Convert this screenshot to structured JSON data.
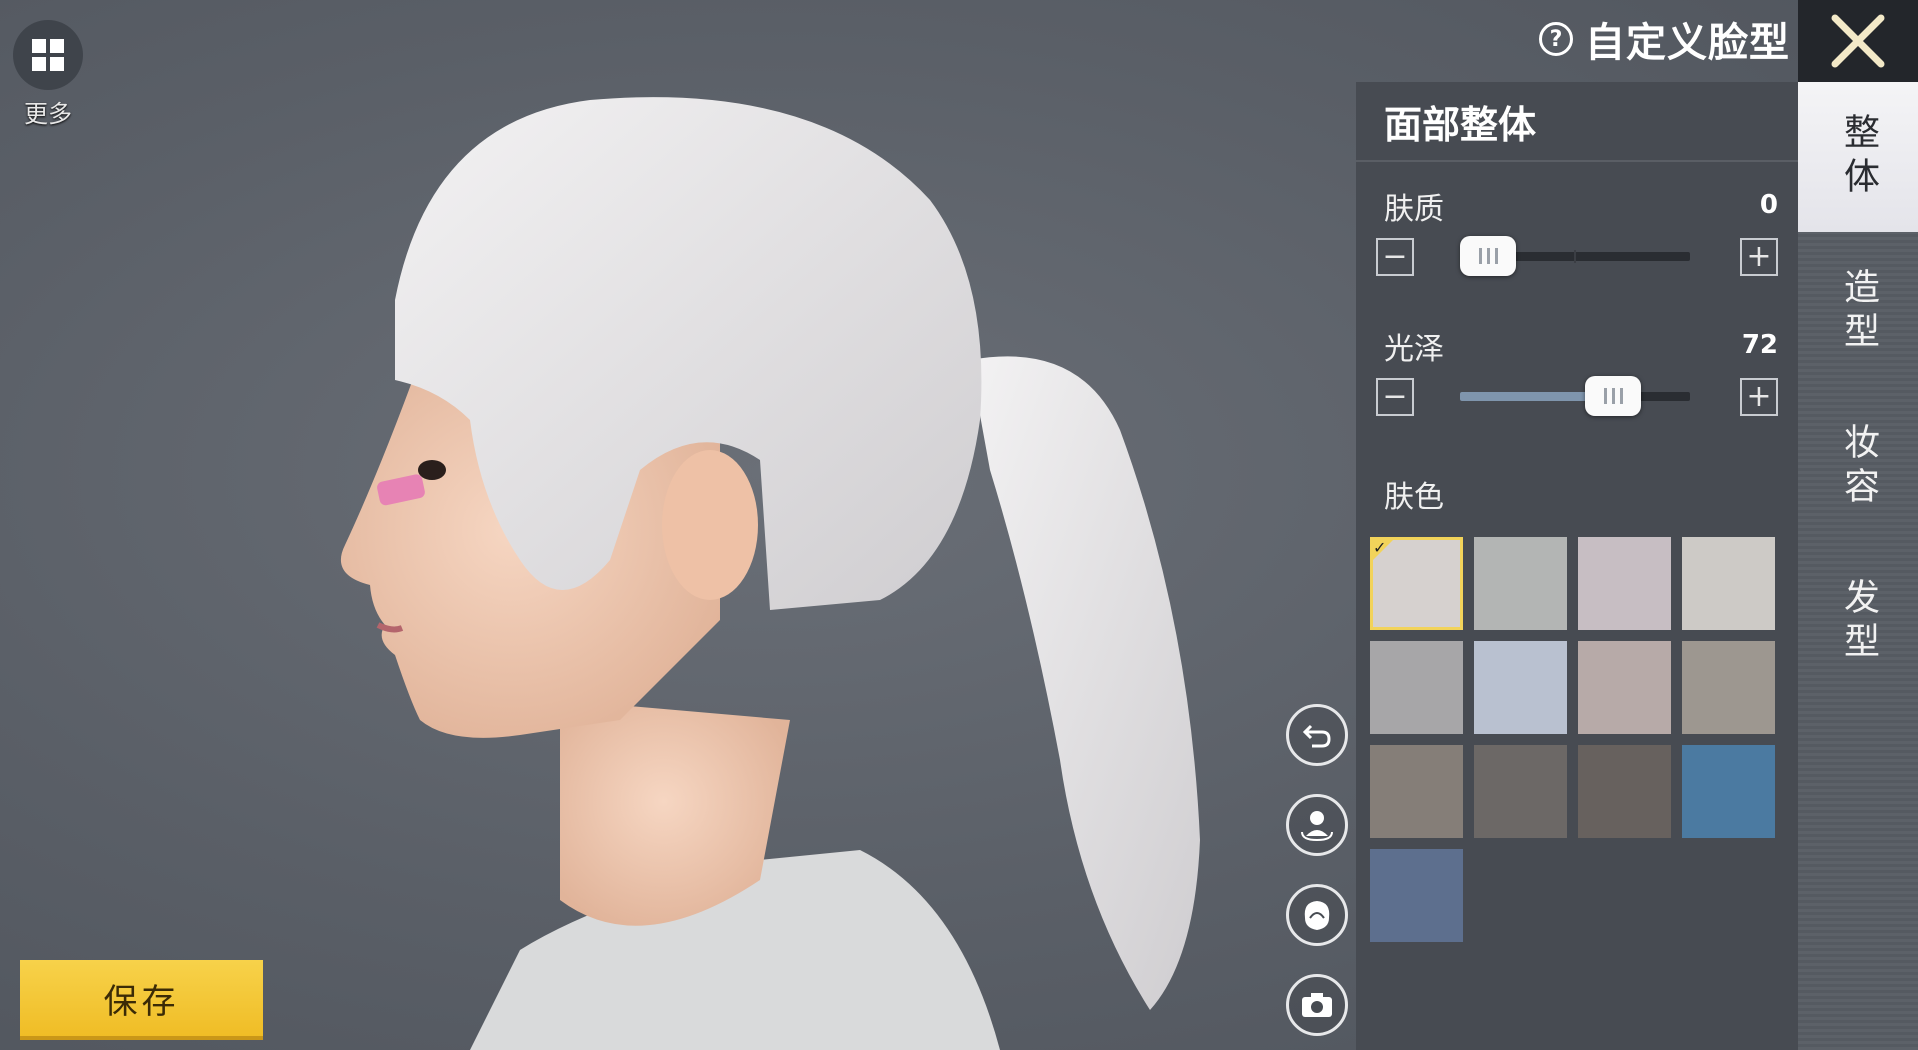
{
  "more": {
    "label": "更多",
    "icon": "grid-icon"
  },
  "header": {
    "title": "自定义脸型",
    "help_icon": "question-icon",
    "close_icon": "close-icon"
  },
  "tabs": [
    {
      "label": "整体",
      "active": true
    },
    {
      "label": "造型",
      "active": false
    },
    {
      "label": "妆容",
      "active": false
    },
    {
      "label": "发型",
      "active": false
    }
  ],
  "panel": {
    "title": "面部整体",
    "sliders": [
      {
        "label": "肤质",
        "value": "0",
        "fraction": 0.0,
        "minus": "−",
        "plus": "+"
      },
      {
        "label": "光泽",
        "value": "72",
        "fraction": 0.72,
        "minus": "−",
        "plus": "+"
      }
    ],
    "skin_color": {
      "label": "肤色",
      "selected_index": 0,
      "check": "✓",
      "swatches": [
        "#d6d1cf",
        "#b3b5b4",
        "#c7bec3",
        "#cdcac6",
        "#a7a6a8",
        "#b9c1d0",
        "#b7aaa8",
        "#9d9790",
        "#857e78",
        "#6c6866",
        "#67615e",
        "#4b7aa1",
        "#5d6f8e"
      ]
    }
  },
  "tools": [
    "undo-icon",
    "rotate-view-icon",
    "hair-view-icon",
    "camera-icon"
  ],
  "save": {
    "label": "保存"
  }
}
